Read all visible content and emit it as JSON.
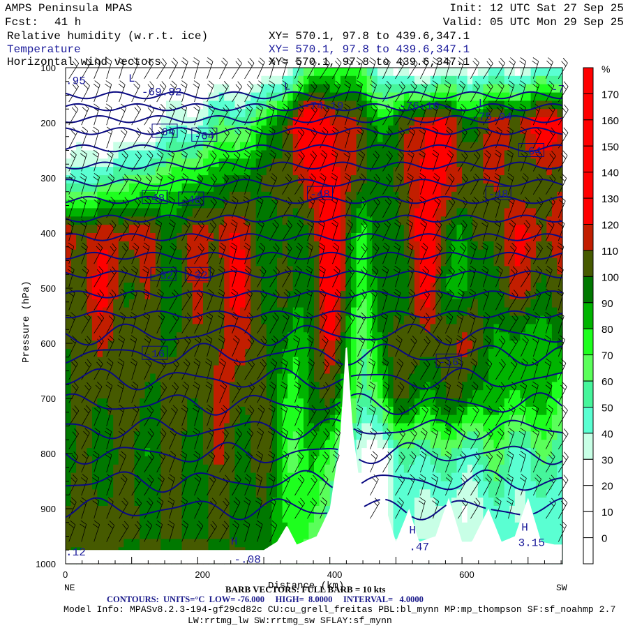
{
  "header": {
    "model": "AMPS Peninsula MPAS",
    "fcst_label": "Fcst:",
    "fcst_value": "41 h",
    "init": "Init: 12 UTC Sat 27 Sep 25",
    "valid": "Valid: 05 UTC Mon 29 Sep 25",
    "fields": [
      {
        "name": "Relative humidity (w.r.t. ice)",
        "xy": "XY= 570.1, 97.8 to 439.6,347.1"
      },
      {
        "name": "Temperature",
        "xy": "XY= 570.1, 97.8 to 439.6,347.1"
      },
      {
        "name": "Horizontal wind vectors",
        "xy": "XY= 570.1, 97.8 to 439.6,347.1"
      }
    ]
  },
  "footer": {
    "barb_note": "BARB VECTORS: FULL BARB = 10 kts",
    "contours_note": "CONTOURS:  UNITS=°C  LOW= -76.000     HIGH=  8.0000     INTERVAL=   4.0000",
    "model_info_1": "Model Info: MPASv8.2.3-194-gf29cd82c CU:cu_grell_freitas PBL:bl_mynn MP:mp_thompson SF:sf_noahmp 2.7",
    "model_info_2": "LW:rrtmg_lw SW:rrtmg_sw SFLAY:sf_mynn",
    "left_end": "NE",
    "right_end": "SW"
  },
  "chart_data": {
    "type": "heatmap",
    "title": "Relative humidity (w.r.t. ice)",
    "xlabel": "Distance (km)",
    "ylabel": "Pressure (hPa)",
    "xlim": [
      0,
      752
    ],
    "ylim": [
      100,
      1000
    ],
    "x_ticks": [
      "0",
      "200",
      "400",
      "600"
    ],
    "x_tick_values": [
      0,
      200,
      400,
      600
    ],
    "y_ticks": [
      "100",
      "200",
      "300",
      "400",
      "500",
      "600",
      "700",
      "800",
      "900",
      "1000"
    ],
    "y_tick_values": [
      100,
      200,
      300,
      400,
      500,
      600,
      700,
      800,
      900,
      1000
    ],
    "rh_grid": {
      "distance_km": [
        0,
        50,
        100,
        150,
        200,
        250,
        300,
        350,
        400,
        450,
        500,
        550,
        600,
        650,
        700,
        750
      ],
      "pressure_hpa": [
        100,
        200,
        300,
        400,
        500,
        600,
        700,
        800,
        900,
        1000
      ],
      "rh_percent": [
        [
          10,
          10,
          10,
          10,
          10,
          10,
          10,
          40,
          80,
          60,
          20,
          20,
          30,
          30,
          30,
          40
        ],
        [
          10,
          10,
          10,
          30,
          40,
          60,
          70,
          130,
          130,
          100,
          90,
          130,
          100,
          110,
          120,
          130
        ],
        [
          40,
          50,
          60,
          70,
          80,
          90,
          100,
          110,
          130,
          100,
          100,
          130,
          110,
          110,
          100,
          110
        ],
        [
          120,
          110,
          120,
          100,
          110,
          120,
          100,
          90,
          130,
          80,
          100,
          130,
          85,
          110,
          120,
          110
        ],
        [
          105,
          120,
          105,
          100,
          105,
          120,
          105,
          90,
          130,
          75,
          95,
          120,
          80,
          105,
          110,
          100
        ],
        [
          100,
          110,
          105,
          100,
          105,
          115,
          105,
          80,
          120,
          60,
          110,
          100,
          115,
          90,
          80,
          90
        ],
        [
          95,
          105,
          105,
          100,
          105,
          110,
          100,
          75,
          110,
          50,
          100,
          90,
          100,
          80,
          85,
          75
        ],
        [
          90,
          100,
          95,
          100,
          100,
          105,
          100,
          70,
          80,
          20,
          40,
          60,
          50,
          60,
          50,
          60
        ],
        [
          100,
          105,
          100,
          100,
          100,
          100,
          95,
          75,
          60,
          10,
          40,
          40,
          30,
          45,
          40,
          45
        ],
        [
          100,
          105,
          100,
          100,
          100,
          100,
          95,
          75,
          60,
          10,
          40,
          40,
          30,
          45,
          40,
          45
        ]
      ]
    },
    "surface_pressure": {
      "distance_km": [
        0,
        300,
        320,
        335,
        350,
        380,
        400,
        415,
        425,
        435,
        450,
        465,
        480,
        500,
        520,
        535,
        560,
        580,
        600,
        615,
        640,
        660,
        680,
        700,
        720,
        740,
        752
      ],
      "pressure_hpa": [
        975,
        975,
        960,
        930,
        965,
        950,
        900,
        780,
        590,
        760,
        900,
        960,
        880,
        960,
        900,
        960,
        950,
        880,
        960,
        960,
        900,
        960,
        950,
        880,
        960,
        965,
        965
      ]
    },
    "colorbar": {
      "unit": "%",
      "labels": [
        "170",
        "160",
        "150",
        "140",
        "130",
        "120",
        "110",
        "100",
        "90",
        "80",
        "70",
        "60",
        "50",
        "40",
        "30",
        "20",
        "10",
        "0"
      ],
      "thresholds": [
        0,
        10,
        20,
        30,
        40,
        50,
        60,
        70,
        80,
        90,
        100,
        110,
        120,
        130,
        140,
        150,
        160,
        170
      ],
      "colors": [
        "#ffffff",
        "#ffffff",
        "#ffffff",
        "#ffffff",
        "#c8ffe6",
        "#5affd2",
        "#46f59b",
        "#5aff5a",
        "#1eff1e",
        "#00b400",
        "#007800",
        "#465a00",
        "#c21e00",
        "#ff0000",
        "#ff0000",
        "#ff0000",
        "#ff0000",
        "#ff0000",
        "#ff0000"
      ]
    },
    "temperature_contours": {
      "units": "°C",
      "low": -76,
      "high": 8,
      "interval": 4,
      "level_pressure_temp": [
        [
          -76,
          150
        ],
        [
          -64,
          215
        ],
        [
          -48,
          340
        ],
        [
          -32,
          475
        ],
        [
          -16,
          620
        ],
        [
          0,
          800
        ],
        [
          8,
          900
        ]
      ],
      "labels": [
        {
          "text": "-64",
          "d": 150,
          "p": 215
        },
        {
          "text": "-64",
          "d": 210,
          "p": 222
        },
        {
          "text": "-64",
          "d": 705,
          "p": 250
        },
        {
          "text": "-48",
          "d": 135,
          "p": 335
        },
        {
          "text": "-48",
          "d": 190,
          "p": 338
        },
        {
          "text": "-48",
          "d": 385,
          "p": 328
        },
        {
          "text": "-48",
          "d": 655,
          "p": 328
        },
        {
          "text": "-32",
          "d": 148,
          "p": 475
        },
        {
          "text": "-32",
          "d": 200,
          "p": 475
        },
        {
          "text": "-16",
          "d": 135,
          "p": 618
        },
        {
          "text": "-16",
          "d": 580,
          "p": 632
        }
      ],
      "extrema": [
        {
          "text": "L",
          "d": 95,
          "p": 125
        },
        {
          "text": "-69.82",
          "d": 115,
          "p": 150
        },
        {
          "text": ".95",
          "d": 0,
          "p": 130
        },
        {
          "text": "L",
          "d": 330,
          "p": 140
        },
        {
          "text": "-74.19",
          "d": 360,
          "p": 175
        },
        {
          "text": "-76.16",
          "d": 505,
          "p": 175
        },
        {
          "text": "L",
          "d": 625,
          "p": 170
        },
        {
          "text": "-75.04",
          "d": 615,
          "p": 195
        },
        {
          "text": "-7",
          "d": 735,
          "p": 145
        },
        {
          "text": ".12",
          "d": 0,
          "p": 985
        },
        {
          "text": "-.08",
          "d": 255,
          "p": 998
        },
        {
          "text": "H",
          "d": 250,
          "p": 965
        },
        {
          "text": ".47",
          "d": 520,
          "p": 975
        },
        {
          "text": "H",
          "d": 520,
          "p": 945
        },
        {
          "text": "3.15",
          "d": 685,
          "p": 968
        },
        {
          "text": "H",
          "d": 690,
          "p": 940
        }
      ]
    }
  }
}
